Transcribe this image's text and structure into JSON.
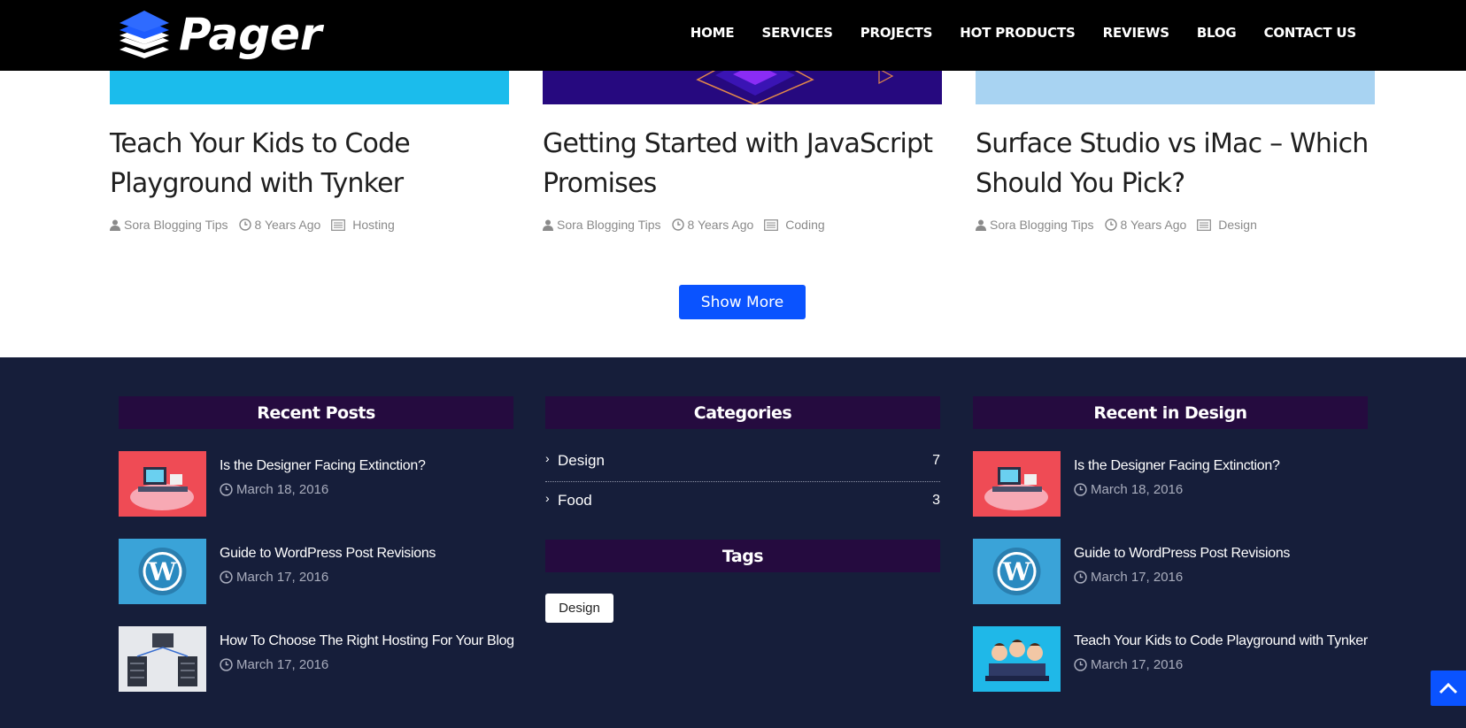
{
  "header": {
    "logo_text": "Pager",
    "nav": [
      "HOME",
      "SERVICES",
      "PROJECTS",
      "HOT PRODUCTS",
      "REVIEWS",
      "BLOG",
      "CONTACT US"
    ]
  },
  "cards": [
    {
      "title": "Teach Your Kids to Code Playground with Tynker",
      "author": "Sora Blogging Tips",
      "time": "8 Years Ago",
      "category": "Hosting"
    },
    {
      "title": "Getting Started with JavaScript Promises",
      "author": "Sora Blogging Tips",
      "time": "8 Years Ago",
      "category": "Coding"
    },
    {
      "title": "Surface Studio vs iMac – Which Should You Pick?",
      "author": "Sora Blogging Tips",
      "time": "8 Years Ago",
      "category": "Design"
    }
  ],
  "show_more_label": "Show More",
  "footer": {
    "recent_posts": {
      "heading": "Recent Posts",
      "posts": [
        {
          "title": "Is the Designer Facing Extinction?",
          "date": "March 18, 2016"
        },
        {
          "title": "Guide to WordPress Post Revisions",
          "date": "March 17, 2016"
        },
        {
          "title": "How To Choose The Right Hosting For Your Blog",
          "date": "March 17, 2016"
        }
      ]
    },
    "categories": {
      "heading": "Categories",
      "items": [
        {
          "label": "Design",
          "count": "7"
        },
        {
          "label": "Food",
          "count": "3"
        }
      ]
    },
    "tags": {
      "heading": "Tags",
      "items": [
        "Design"
      ]
    },
    "recent_design": {
      "heading": "Recent in Design",
      "posts": [
        {
          "title": "Is the Designer Facing Extinction?",
          "date": "March 18, 2016"
        },
        {
          "title": "Guide to WordPress Post Revisions",
          "date": "March 17, 2016"
        },
        {
          "title": "Teach Your Kids to Code Playground with Tynker",
          "date": "March 17, 2016"
        }
      ]
    }
  },
  "colors": {
    "header_bg": "#000000",
    "footer_bg": "#161e3a",
    "widget_head_bg": "#250b3f",
    "accent": "#0a53ff"
  },
  "icons": {
    "author": "user-icon",
    "time": "clock-icon",
    "category": "list-icon",
    "category_arrow": "chevron-right-icon",
    "back_to_top": "chevron-up-icon"
  }
}
